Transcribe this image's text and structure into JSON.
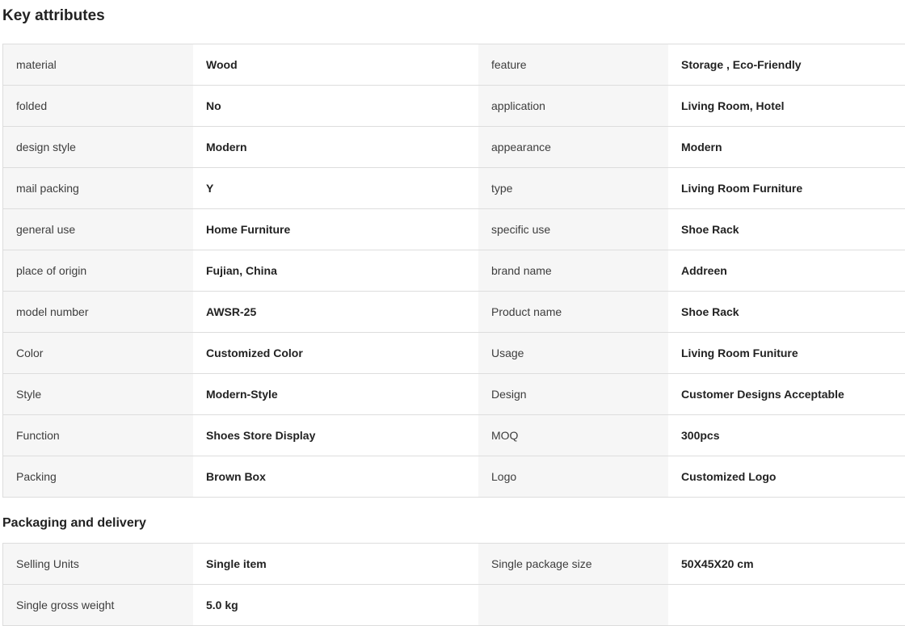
{
  "key_attributes": {
    "title": "Key attributes",
    "rows": [
      {
        "l1": "material",
        "v1": "Wood",
        "l2": "feature",
        "v2": "Storage , Eco-Friendly"
      },
      {
        "l1": "folded",
        "v1": "No",
        "l2": "application",
        "v2": "Living Room, Hotel"
      },
      {
        "l1": "design style",
        "v1": "Modern",
        "l2": "appearance",
        "v2": "Modern"
      },
      {
        "l1": "mail packing",
        "v1": "Y",
        "l2": "type",
        "v2": "Living Room Furniture"
      },
      {
        "l1": "general use",
        "v1": "Home Furniture",
        "l2": "specific use",
        "v2": "Shoe Rack"
      },
      {
        "l1": "place of origin",
        "v1": "Fujian, China",
        "l2": "brand name",
        "v2": "Addreen"
      },
      {
        "l1": "model number",
        "v1": "AWSR-25",
        "l2": "Product name",
        "v2": "Shoe Rack"
      },
      {
        "l1": "Color",
        "v1": "Customized Color",
        "l2": "Usage",
        "v2": "Living Room Funiture"
      },
      {
        "l1": "Style",
        "v1": "Modern-Style",
        "l2": "Design",
        "v2": "Customer Designs Acceptable"
      },
      {
        "l1": "Function",
        "v1": "Shoes Store Display",
        "l2": "MOQ",
        "v2": "300pcs"
      },
      {
        "l1": "Packing",
        "v1": "Brown Box",
        "l2": "Logo",
        "v2": "Customized Logo"
      }
    ]
  },
  "packaging": {
    "title": "Packaging and delivery",
    "rows": [
      {
        "l1": "Selling Units",
        "v1": "Single item",
        "l2": "Single package size",
        "v2": "50X45X20 cm"
      },
      {
        "l1": "Single gross weight",
        "v1": "5.0 kg",
        "l2": "",
        "v2": ""
      }
    ]
  }
}
